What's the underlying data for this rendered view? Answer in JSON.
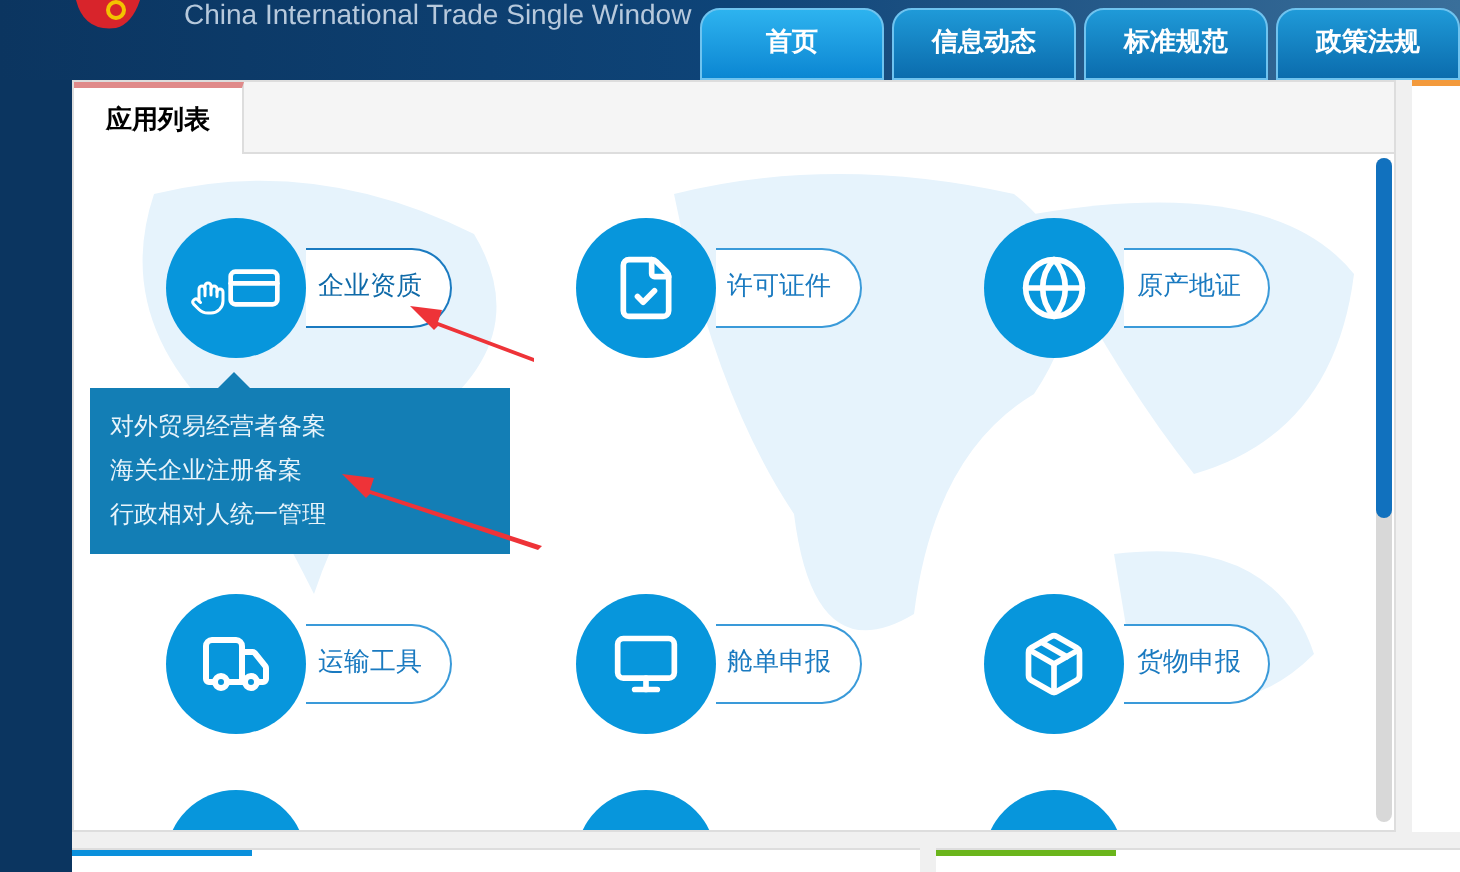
{
  "header": {
    "title": "China International Trade Single Window",
    "nav_tabs": [
      {
        "label": "首页",
        "selected": true
      },
      {
        "label": "信息动态",
        "selected": false
      },
      {
        "label": "标准规范",
        "selected": false
      },
      {
        "label": "政策法规",
        "selected": false
      }
    ]
  },
  "app_panel": {
    "tab": "应用列表",
    "apps": [
      {
        "label": "企业资质",
        "kind": "card",
        "expanded": true,
        "menu": [
          "对外贸易经营者备案",
          "海关企业注册备案",
          "行政相对人统一管理"
        ]
      },
      {
        "label": "许可证件",
        "kind": "form",
        "expanded": false
      },
      {
        "label": "原产地证",
        "kind": "globe",
        "expanded": false
      },
      {
        "label": "运输工具",
        "kind": "truck",
        "expanded": false
      },
      {
        "label": "舱单申报",
        "kind": "monitor",
        "expanded": false
      },
      {
        "label": "货物申报",
        "kind": "boxes",
        "expanded": false
      }
    ]
  }
}
